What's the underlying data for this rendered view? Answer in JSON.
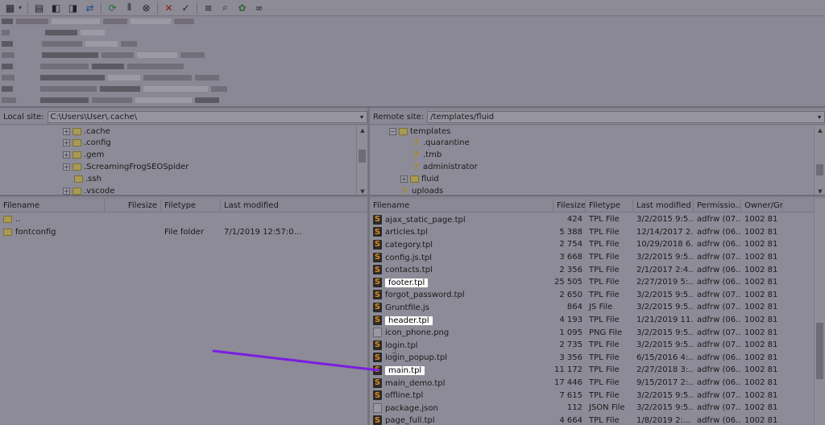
{
  "toolbar": {
    "icons": [
      "site-manager-icon",
      "arrow-down-icon",
      "toggle-log-icon",
      "toggle-local-tree-icon",
      "toggle-remote-tree-icon",
      "toggle-queue-icon",
      "refresh-icon",
      "filter-icon",
      "cancel-icon",
      "disconnect-icon",
      "reconnect-icon",
      "directory-compare-icon",
      "sync-browse-icon",
      "search-icon",
      "find-icon",
      "binoculars-icon"
    ]
  },
  "local": {
    "site_label": "Local site:",
    "path": "C:\\Users\\User\\.cache\\",
    "tree": [
      ".cache",
      ".config",
      ".gem",
      ".ScreamingFrogSEOSpider",
      ".ssh",
      ".vscode"
    ],
    "columns": [
      "Filename",
      "Filesize",
      "Filetype",
      "Last modified"
    ],
    "files": [
      {
        "name": "..",
        "size": "",
        "type": "",
        "modified": ""
      },
      {
        "name": "fontconfig",
        "size": "",
        "type": "File folder",
        "modified": "7/1/2019 12:57:0..."
      }
    ]
  },
  "remote": {
    "site_label": "Remote site:",
    "path": "/templates/fluid",
    "tree": [
      {
        "label": "templates",
        "kind": "folder",
        "expander": "-"
      },
      {
        "label": ".quarantine",
        "kind": "unknown",
        "expander": ""
      },
      {
        "label": ".tmb",
        "kind": "unknown",
        "expander": ""
      },
      {
        "label": "administrator",
        "kind": "unknown",
        "expander": ""
      },
      {
        "label": "fluid",
        "kind": "folder",
        "expander": "+"
      },
      {
        "label": "uploads",
        "kind": "unknown",
        "expander": ""
      }
    ],
    "columns": [
      "Filename",
      "Filesize",
      "Filetype",
      "Last modified",
      "Permissio...",
      "Owner/Gr..."
    ],
    "files": [
      {
        "name": "ajax_static_page.tpl",
        "size": "424",
        "type": "TPL File",
        "modified": "3/2/2015 9:5...",
        "perm": "adfrw (07...",
        "owner": "1002 81",
        "hl": false
      },
      {
        "name": "articles.tpl",
        "size": "5 388",
        "type": "TPL File",
        "modified": "12/14/2017 2...",
        "perm": "adfrw (06...",
        "owner": "1002 81",
        "hl": false
      },
      {
        "name": "category.tpl",
        "size": "2 754",
        "type": "TPL File",
        "modified": "10/29/2018 6...",
        "perm": "adfrw (06...",
        "owner": "1002 81",
        "hl": false
      },
      {
        "name": "config.js.tpl",
        "size": "3 668",
        "type": "TPL File",
        "modified": "3/2/2015 9:5...",
        "perm": "adfrw (07...",
        "owner": "1002 81",
        "hl": false
      },
      {
        "name": "contacts.tpl",
        "size": "2 356",
        "type": "TPL File",
        "modified": "2/1/2017 2:4...",
        "perm": "adfrw (06...",
        "owner": "1002 81",
        "hl": false
      },
      {
        "name": "footer.tpl",
        "size": "25 505",
        "type": "TPL File",
        "modified": "2/27/2019 5:...",
        "perm": "adfrw (06...",
        "owner": "1002 81",
        "hl": true
      },
      {
        "name": "forgot_password.tpl",
        "size": "2 650",
        "type": "TPL File",
        "modified": "3/2/2015 9:5...",
        "perm": "adfrw (07...",
        "owner": "1002 81",
        "hl": false
      },
      {
        "name": "Gruntfile.js",
        "size": "864",
        "type": "JS File",
        "modified": "3/2/2015 9:5...",
        "perm": "adfrw (07...",
        "owner": "1002 81",
        "hl": false
      },
      {
        "name": "header.tpl",
        "size": "4 193",
        "type": "TPL File",
        "modified": "1/21/2019 11...",
        "perm": "adfrw (06...",
        "owner": "1002 81",
        "hl": true
      },
      {
        "name": "icon_phone.png",
        "size": "1 095",
        "type": "PNG File",
        "modified": "3/2/2015 9:5...",
        "perm": "adfrw (07...",
        "owner": "1002 81",
        "hl": false
      },
      {
        "name": "login.tpl",
        "size": "2 735",
        "type": "TPL File",
        "modified": "3/2/2015 9:5...",
        "perm": "adfrw (07...",
        "owner": "1002 81",
        "hl": false
      },
      {
        "name": "login_popup.tpl",
        "size": "3 356",
        "type": "TPL File",
        "modified": "6/15/2016 4:...",
        "perm": "adfrw (06...",
        "owner": "1002 81",
        "hl": false
      },
      {
        "name": "main.tpl",
        "size": "11 172",
        "type": "TPL File",
        "modified": "2/27/2018 3:...",
        "perm": "adfrw (06...",
        "owner": "1002 81",
        "hl": true
      },
      {
        "name": "main_demo.tpl",
        "size": "17 446",
        "type": "TPL File",
        "modified": "9/15/2017 2:...",
        "perm": "adfrw (06...",
        "owner": "1002 81",
        "hl": false
      },
      {
        "name": "offline.tpl",
        "size": "7 615",
        "type": "TPL File",
        "modified": "3/2/2015 9:5...",
        "perm": "adfrw (07...",
        "owner": "1002 81",
        "hl": false
      },
      {
        "name": "package.json",
        "size": "112",
        "type": "JSON File",
        "modified": "3/2/2015 9:5...",
        "perm": "adfrw (07...",
        "owner": "1002 81",
        "hl": false
      },
      {
        "name": "page_full.tpl",
        "size": "4 664",
        "type": "TPL File",
        "modified": "1/8/2019 2:...",
        "perm": "adfrw (06...",
        "owner": "1002 81",
        "hl": false
      }
    ]
  },
  "annotation_color": "#7a1ee0"
}
